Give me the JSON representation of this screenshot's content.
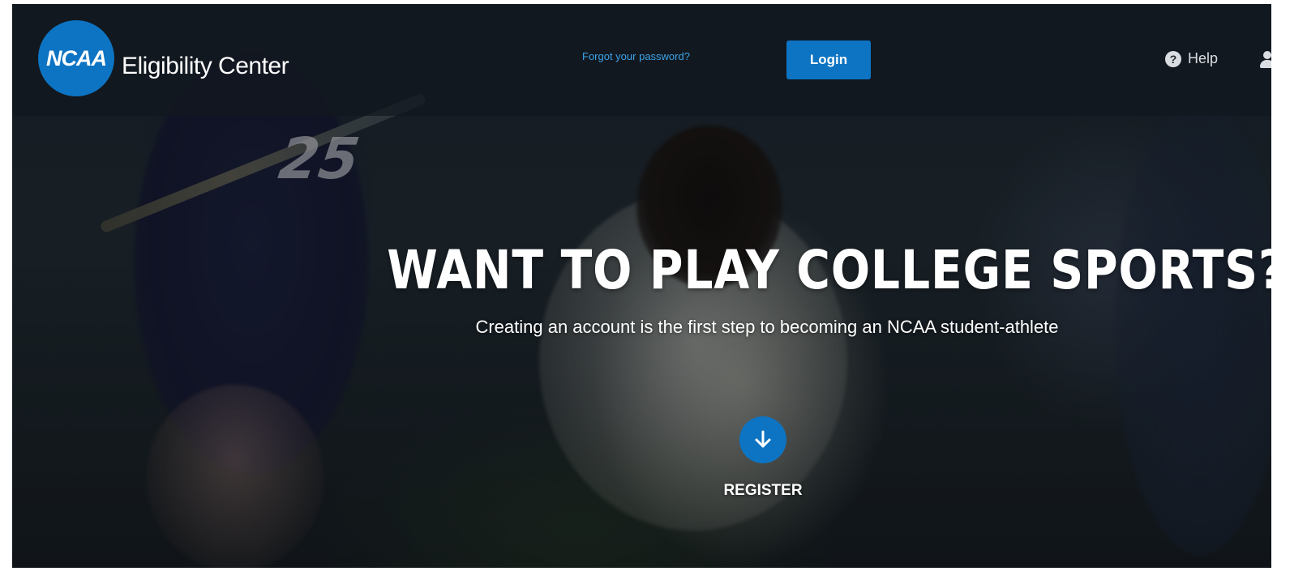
{
  "header": {
    "logo_text": "NCAA",
    "brand_name": "Eligibility Center",
    "forgot_password_link": "Forgot your password?",
    "login_button": "Login",
    "help_link": "Help",
    "help_icon_glyph": "?",
    "icons": [
      "help-circle-icon",
      "user-icon"
    ]
  },
  "background": {
    "jersey_number": "25"
  },
  "hero": {
    "headline": "WANT TO PLAY COLLEGE SPORTS?",
    "subheadline": "Creating an account is the first step to becoming an NCAA student-athlete",
    "register_icon": "arrow-down-icon",
    "register_label": "REGISTER"
  },
  "colors": {
    "brand_blue": "#0d74c3",
    "link_blue": "#3ba4ea",
    "text_white": "#ffffff"
  }
}
